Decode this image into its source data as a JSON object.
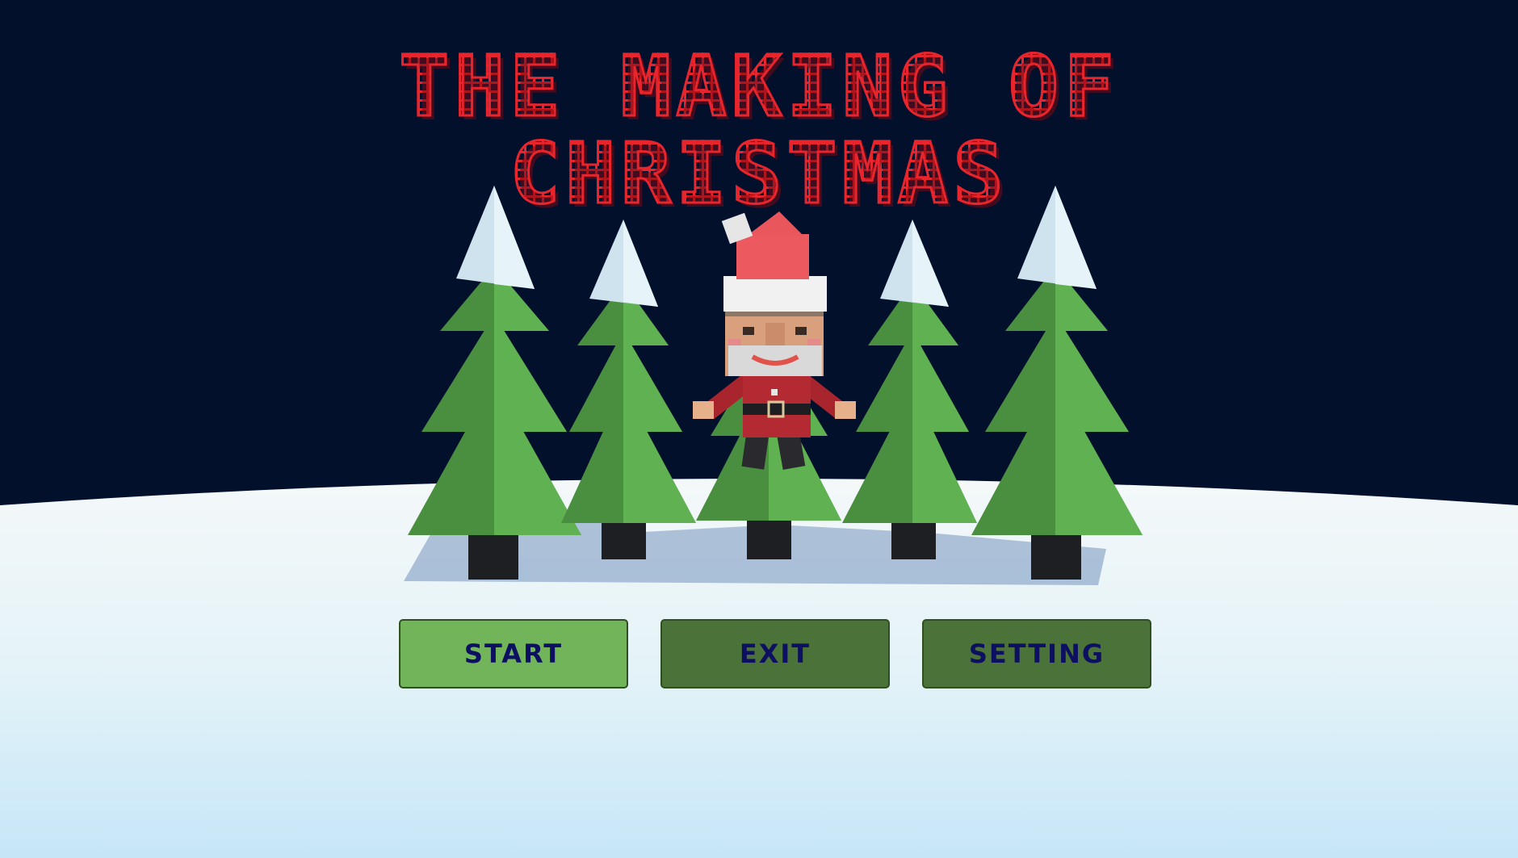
{
  "title": {
    "line1": "THE MAKING OF",
    "line2": "CHRISTMAS"
  },
  "menu": {
    "start_label": "START",
    "exit_label": "EXIT",
    "setting_label": "SETTING"
  },
  "colors": {
    "sky": "#02102c",
    "snow": "#eef7fb",
    "title_red": "#e8242c",
    "button_active": "#72b45a",
    "button": "#4b7238",
    "button_text": "#0d1060",
    "tree_green": "#5aa04f"
  }
}
